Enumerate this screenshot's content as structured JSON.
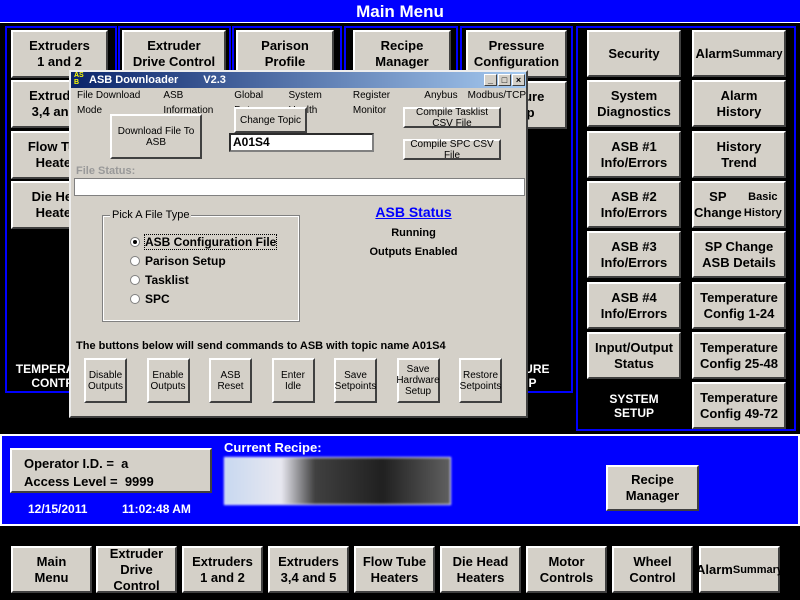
{
  "header": {
    "title": "Main Menu"
  },
  "left_columns": [
    {
      "buttons": [
        "Extruders\n1 and 2",
        "Extruders\n3,4 and 5",
        "Flow Tube\nHeaters",
        "Die Head\nHeaters"
      ],
      "footer": "TEMPERATURE\nCONTROL"
    },
    {
      "buttons": [
        "Extruder\nDrive Control"
      ]
    },
    {
      "buttons": [
        "Parison\nProfile"
      ]
    },
    {
      "buttons": [
        "Recipe\nManager"
      ]
    },
    {
      "buttons": [
        "Pressure\nConfiguration",
        "Pressure\nSetup"
      ],
      "footer": "PRESSURE\nSETUP"
    }
  ],
  "system_setup": {
    "left": [
      "Security",
      "System\nDiagnostics",
      "ASB #1\nInfo/Errors",
      "ASB #2\nInfo/Errors",
      "ASB #3\nInfo/Errors",
      "ASB #4\nInfo/Errors",
      "Input/Output\nStatus"
    ],
    "right": [
      "Alarm\nSummary",
      "Alarm\nHistory",
      "History\nTrend",
      "SP Change\nBasic History",
      "SP Change\nASB Details",
      "Temperature\nConfig 1-24",
      "Temperature\nConfig 25-48",
      "Temperature\nConfig 49-72"
    ],
    "label": "SYSTEM\nSETUP"
  },
  "dialog": {
    "title": "ASB Downloader",
    "version": "V2.3",
    "icon_text": "ASB",
    "menu": [
      "File Download Mode",
      "ASB Information",
      "Global Data",
      "System Health",
      "Register Monitor",
      "Anybus",
      "Modbus/TCP"
    ],
    "download_button": "Download File To ASB",
    "change_topic_button": "Change Topic",
    "topic_value": "A01S4",
    "compile_tasklist_button": "Compile Tasklist CSV File",
    "compile_spc_button": "Compile SPC CSV File",
    "file_status_label": "File Status:",
    "file_status_value": "",
    "file_type_group": "Pick A File Type",
    "file_types": [
      "ASB Configuration File",
      "Parison Setup",
      "Tasklist",
      "SPC"
    ],
    "selected_file_type": "ASB Configuration File",
    "status_title": "ASB Status",
    "status_lines": [
      "Running",
      "Outputs Enabled"
    ],
    "commands_note": "The buttons below will send commands to ASB with topic name A01S4",
    "command_buttons": [
      "Disable\nOutputs",
      "Enable\nOutputs",
      "ASB\nReset",
      "Enter Idle",
      "Save\nSetpoints",
      "Save\nHardware\nSetup",
      "Restore\nSetpoints"
    ]
  },
  "operator": {
    "id_line": "Operator I.D. =  a",
    "access_line": "Access Level =  9999"
  },
  "date": "12/15/2011",
  "time": "11:02:48 AM",
  "current_recipe_label": "Current Recipe:",
  "recipe_manager_button": "Recipe\nManager",
  "bottom_nav": [
    "Main\nMenu",
    "Extruder\nDrive Control",
    "Extruders\n1 and 2",
    "Extruders\n3,4 and 5",
    "Flow Tube\nHeaters",
    "Die Head\nHeaters",
    "Motor\nControls",
    "Wheel\nControl",
    "Alarm\nSummary"
  ],
  "colors": {
    "accent_blue": "#0000ff",
    "button_gray": "#d4d0c8",
    "link_blue": "#0000ff"
  }
}
